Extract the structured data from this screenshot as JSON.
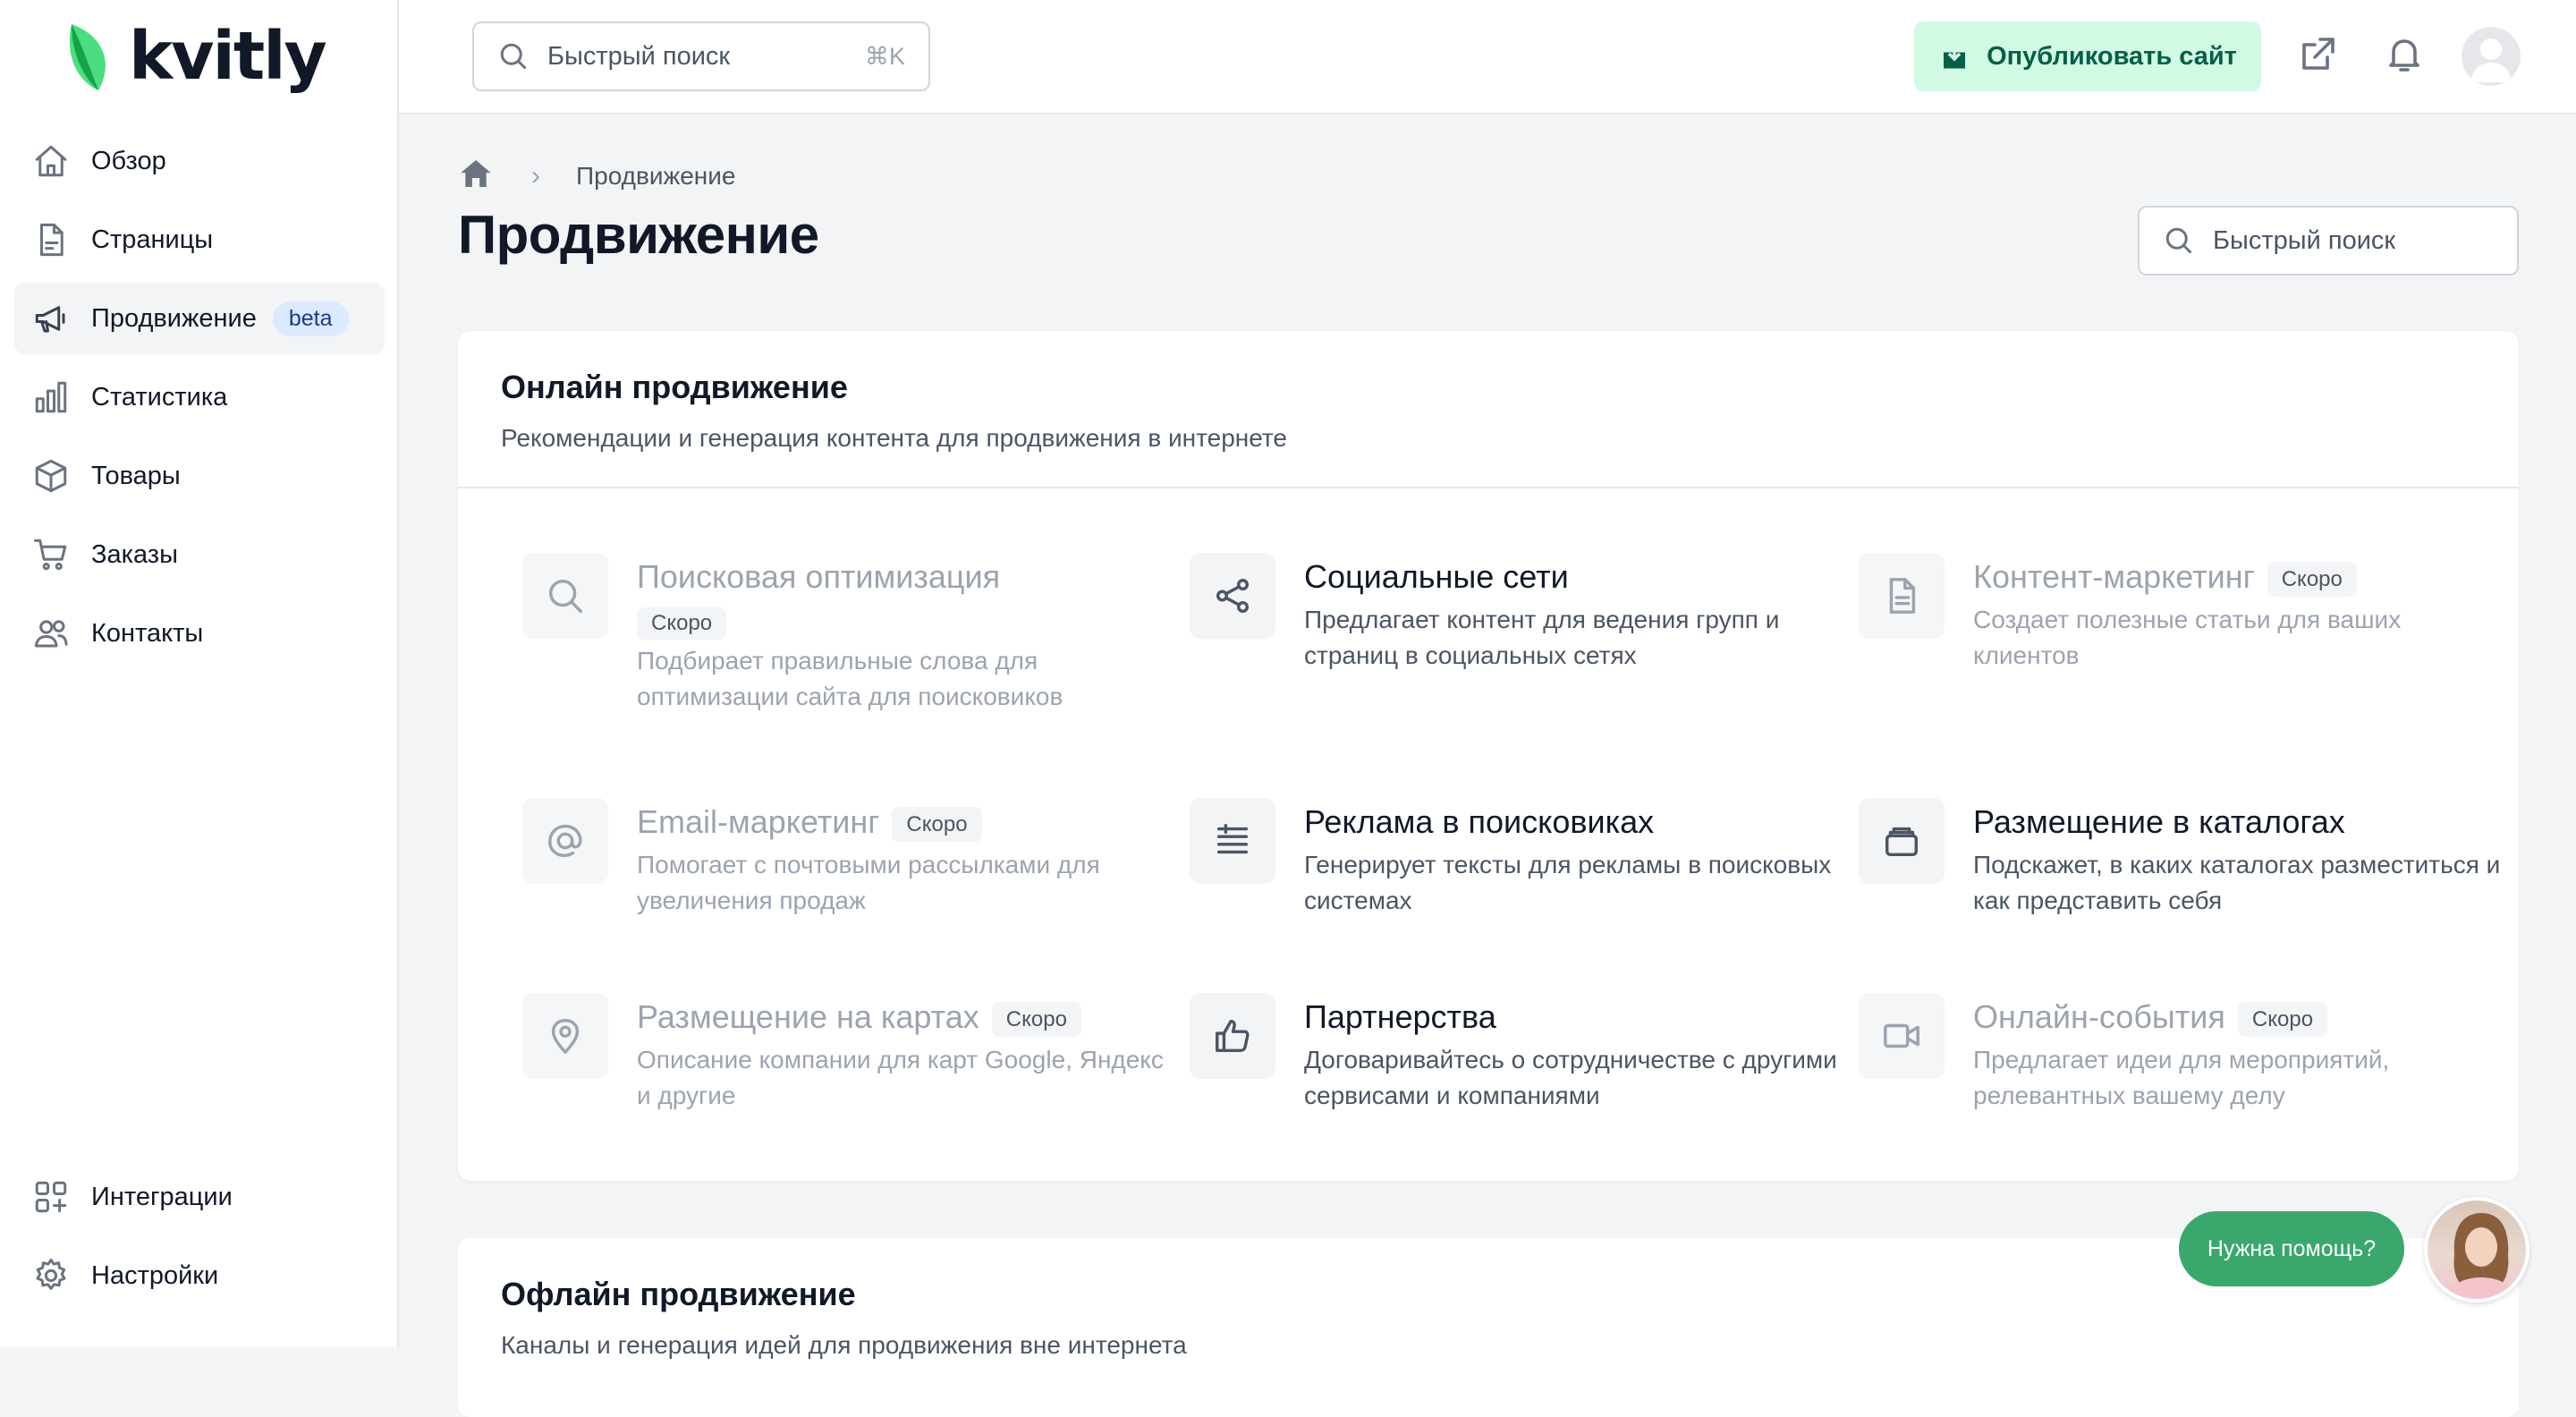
{
  "brand": {
    "name": "kvitly",
    "color": "#22c55e"
  },
  "sidebar": {
    "items": [
      {
        "label": "Обзор",
        "icon": "home-icon"
      },
      {
        "label": "Страницы",
        "icon": "document-icon"
      },
      {
        "label": "Продвижение",
        "icon": "megaphone-icon",
        "badge": "beta",
        "active": true
      },
      {
        "label": "Статистика",
        "icon": "bar-chart-icon"
      },
      {
        "label": "Товары",
        "icon": "cube-icon"
      },
      {
        "label": "Заказы",
        "icon": "cart-icon"
      },
      {
        "label": "Контакты",
        "icon": "users-icon"
      }
    ],
    "bottom": [
      {
        "label": "Интеграции",
        "icon": "apps-plus-icon"
      },
      {
        "label": "Настройки",
        "icon": "gear-icon"
      }
    ]
  },
  "header": {
    "search_placeholder": "Быстрый поиск",
    "search_shortcut": "⌘K",
    "publish_label": "Опубликовать сайт",
    "publish_bg": "#d1fae5",
    "publish_color": "#065f46"
  },
  "breadcrumb": {
    "current": "Продвижение"
  },
  "page": {
    "title": "Продвижение",
    "search_placeholder": "Быстрый поиск"
  },
  "online": {
    "title": "Онлайн продвижение",
    "subtitle": "Рекомендации и генерация контента для продвижения в интернете",
    "features": [
      {
        "title": "Поисковая оптимизация",
        "badge": "Скоро",
        "desc": "Подбирает правильные слова для оптимизации сайта для поисковиков",
        "icon": "search-icon",
        "soon": true
      },
      {
        "title": "Социальные сети",
        "desc": "Предлагает контент для ведения групп и страниц в социальных сетях",
        "icon": "share-icon",
        "soon": false
      },
      {
        "title": "Контент-маркетинг",
        "badge": "Скоро",
        "desc": "Создает полезные статьи для ваших клиентов",
        "icon": "document-icon",
        "soon": true
      },
      {
        "title": "Email-маркетинг",
        "badge": "Скоро",
        "desc": "Помогает с почтовыми рассылками для увеличения продаж",
        "icon": "at-icon",
        "soon": true
      },
      {
        "title": "Реклама в поисковиках",
        "desc": "Генерирует тексты для рекламы в поисковых системах",
        "icon": "list-icon",
        "soon": false
      },
      {
        "title": "Размещение в каталогах",
        "desc": "Подскажет, в каких каталогах разместиться и как представить себя",
        "icon": "catalog-icon",
        "soon": false
      },
      {
        "title": "Размещение на картах",
        "badge": "Скоро",
        "desc": "Описание компании для карт Google, Яндекс и другие",
        "icon": "map-pin-icon",
        "soon": true
      },
      {
        "title": "Партнерства",
        "desc": "Договаривайтесь о сотрудничестве с другими сервисами и компаниями",
        "icon": "thumbs-up-icon",
        "soon": false
      },
      {
        "title": "Онлайн-события",
        "badge": "Скоро",
        "desc": "Предлагает идеи для мероприятий, релевантных вашему делу",
        "icon": "video-icon",
        "soon": true
      }
    ]
  },
  "offline": {
    "title": "Офлайн продвижение",
    "subtitle": "Каналы и генерация идей для продвижения вне интернета"
  },
  "help": {
    "label": "Нужна помощь?",
    "color": "#3aa76d"
  }
}
